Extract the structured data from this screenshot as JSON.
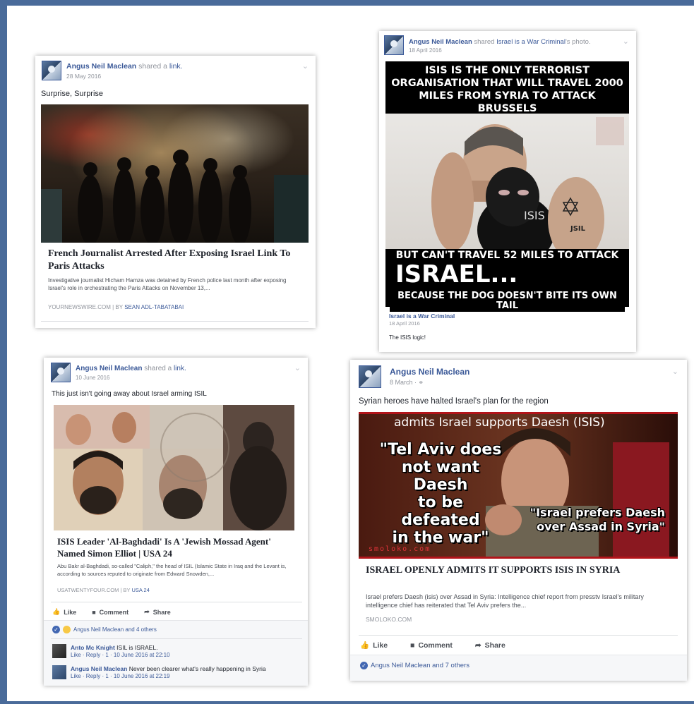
{
  "card1": {
    "author": "Angus Neil Maclean",
    "action": "shared a",
    "object": "link.",
    "date": "28 May 2016",
    "post_text": "Surprise, Surprise",
    "link_title": "French Journalist Arrested After Exposing Israel Link To Paris Attacks",
    "link_desc": "Investigative journalist Hicham Hamza was detained by French police last month after exposing Israel's role in orchestrating the Paris Attacks on November 13,...",
    "link_domain": "YOURNEWSWIRE.COM",
    "link_by_prefix": "| BY",
    "link_by": "SEAN ADL-TABATABAI"
  },
  "card2": {
    "author": "Angus Neil Maclean",
    "action": "shared",
    "object": "Israel is a War Criminal",
    "object_suffix": "'s photo.",
    "date": "18 April 2016",
    "meme_top": "ISIS IS THE ONLY TERRORIST ORGANISATION THAT WILL TRAVEL 2000 MILES FROM SYRIA TO ATTACK BRUSSELS",
    "meme_mid": "BUT CAN'T TRAVEL 52 MILES TO ATTACK",
    "meme_big": "ISRAEL...",
    "meme_bottom": "BECAUSE THE DOG  DOESN'T BITE ITS OWN TAIL",
    "mask_text": "ISIS",
    "tattoo_text": "JSIL",
    "origin_name": "Israel is a War Criminal",
    "origin_date": "18 April 2016",
    "origin_text": "The ISIS logic!"
  },
  "card3": {
    "author": "Angus Neil Maclean",
    "action": "shared a",
    "object": "link.",
    "date": "10 June 2016",
    "post_text": "This just isn't going away about Israel arming ISIL",
    "link_title": "ISIS Leader 'Al-Baghdadi' Is A 'Jewish Mossad Agent' Named Simon Elliot | USA 24",
    "link_desc": "Abu Bakr al-Baghdadi, so-called \"Caliph,\" the head of ISIL (Islamic State in Iraq and the Levant is, according to sources reputed to originate from Edward Snowden,...",
    "link_domain": "USATWENTYFOUR.COM",
    "link_by_prefix": "| BY",
    "link_by": "USA 24",
    "like": "Like",
    "comment": "Comment",
    "share": "Share",
    "likes_text": "Angus Neil Maclean and 4 others",
    "comments": [
      {
        "name": "Anto Mc Knight",
        "text": "ISIL is ISRAEL.",
        "meta": "Like · Reply · 1 · 10 June 2016 at 22:10"
      },
      {
        "name": "Angus Neil Maclean",
        "text": "Never been clearer what's really happening in Syria",
        "meta": "Like · Reply · 1 · 10 June 2016 at 22:19"
      }
    ]
  },
  "card4": {
    "author": "Angus Neil Maclean",
    "date": "8 March",
    "post_text": "Syrian heroes have halted Israel's plan for the region",
    "img_top": "admits Israel supports Daesh (ISIS)",
    "img_quote1_l1": "\"Tel Aviv does",
    "img_quote1_l2": "not want Daesh",
    "img_quote1_l3": "to be defeated",
    "img_quote1_l4": "in the war\"",
    "img_quote2_l1": "\"Israel prefers Daesh",
    "img_quote2_l2": "over Assad in Syria\"",
    "img_watermark": "smoloko.com",
    "link_title": "ISRAEL OPENLY ADMITS IT SUPPORTS ISIS IN SYRIA",
    "link_desc": "Israel prefers Daesh (isis) over Assad in Syria: Intelligence chief report from presstv Israel's military intelligence chief has reiterated that Tel Aviv prefers the...",
    "link_domain": "SMOLOKO.COM",
    "like": "Like",
    "comment": "Comment",
    "share": "Share",
    "likes_text": "Angus Neil Maclean and 7 others"
  },
  "colors": {
    "fb_blue": "#3b5998",
    "frame": "#4a6b9a",
    "meme_red": "#c0141a"
  },
  "icons": [
    "chevron-down-icon",
    "thumbs-up-icon",
    "comment-icon",
    "share-arrow-icon",
    "globe-icon",
    "like-reaction-icon",
    "haha-reaction-icon"
  ]
}
